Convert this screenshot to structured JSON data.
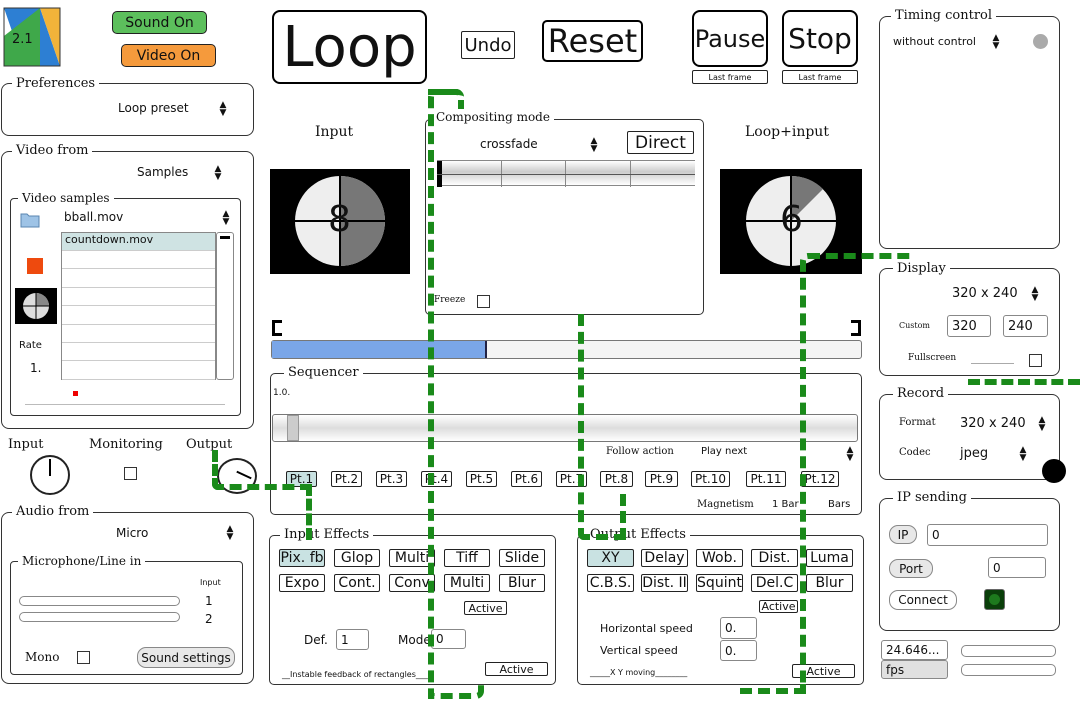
{
  "logo": {
    "version": "2.1"
  },
  "toggles": {
    "sound": "Sound On",
    "video": "Video On"
  },
  "transport": {
    "loop": "Loop",
    "undo": "Undo",
    "reset": "Reset",
    "pause": "Pause",
    "stop": "Stop",
    "pause_sub": "Last frame",
    "stop_sub": "Last frame"
  },
  "preferences": {
    "title": "Preferences",
    "preset": "Loop preset"
  },
  "video_from": {
    "title": "Video from",
    "source": "Samples",
    "samples_title": "Video samples",
    "current_file": "bball.mov",
    "files": [
      "countdown.mov",
      "",
      "",
      "",
      "",
      "",
      "",
      ""
    ],
    "rate_label": "Rate",
    "rate_value": "1."
  },
  "monitor": {
    "input": "Input",
    "monitoring": "Monitoring",
    "output": "Output"
  },
  "audio_from": {
    "title": "Audio from",
    "source": "Micro",
    "mic_title": "Microphone/Line in",
    "input_label": "Input",
    "ch1": "1",
    "ch2": "2",
    "mono": "Mono",
    "settings": "Sound settings"
  },
  "previews": {
    "input_label": "Input",
    "input_number": "8",
    "loop_label": "Loop+input",
    "loop_number": "6"
  },
  "compositing": {
    "title": "Compositing mode",
    "mode": "crossfade",
    "direct": "Direct",
    "freeze": "Freeze"
  },
  "sequencer": {
    "title": "Sequencer",
    "position": "1.0.",
    "follow_action": "Follow action",
    "play_next": "Play next",
    "points": [
      "Pt.1",
      "Pt.2",
      "Pt.3",
      "Pt.4",
      "Pt.5",
      "Pt.6",
      "Pt.7",
      "Pt.8",
      "Pt.9",
      "Pt.10",
      "Pt.11",
      "Pt.12"
    ],
    "magnetism": "Magnetism",
    "bar_value": "1 Bar",
    "bars": "Bars"
  },
  "input_effects": {
    "title": "Input Effects",
    "row1": [
      "Pix. fb",
      "Glop",
      "Multi",
      "Tiff",
      "Slide"
    ],
    "row2": [
      "Expo",
      "Cont.",
      "Conv",
      "Multi",
      "Blur"
    ],
    "active": "Active",
    "def_label": "Def.",
    "def_value": "1",
    "mode_label": "Mode",
    "mode_value": "0",
    "footer": "__Instable feedback  of rectangles___",
    "active2": "Active"
  },
  "output_effects": {
    "title": "Output Effects",
    "row1": [
      "XY",
      "Delay",
      "Wob.",
      "Dist.",
      "Luma"
    ],
    "row2": [
      "C.B.S.",
      "Dist. II",
      "Squint",
      "Del.C",
      "Blur"
    ],
    "active": "Active",
    "hspeed_label": "Horizontal speed",
    "hspeed": "0.",
    "vspeed_label": "Vertical speed",
    "vspeed": "0.",
    "footer": "_____X Y moving________",
    "active2": "Active"
  },
  "timing": {
    "title": "Timing control",
    "mode": "without control"
  },
  "display": {
    "title": "Display",
    "resolution": "320 x 240",
    "custom": "Custom",
    "w": "320",
    "h": "240",
    "fullscreen": "Fullscreen"
  },
  "record": {
    "title": "Record",
    "format_label": "Format",
    "format": "320 x 240",
    "codec_label": "Codec",
    "codec": "jpeg"
  },
  "ip": {
    "title": "IP sending",
    "ip_label": "IP",
    "ip_value": "0",
    "port_label": "Port",
    "port_value": "0",
    "connect": "Connect"
  },
  "fps": {
    "value": "24.646...",
    "label": "fps"
  },
  "colors": {
    "green_toggle": "#5cbf5c",
    "orange_toggle": "#f59a3c",
    "cable": "#1a8a1a",
    "progress": "#7aa6e8"
  }
}
